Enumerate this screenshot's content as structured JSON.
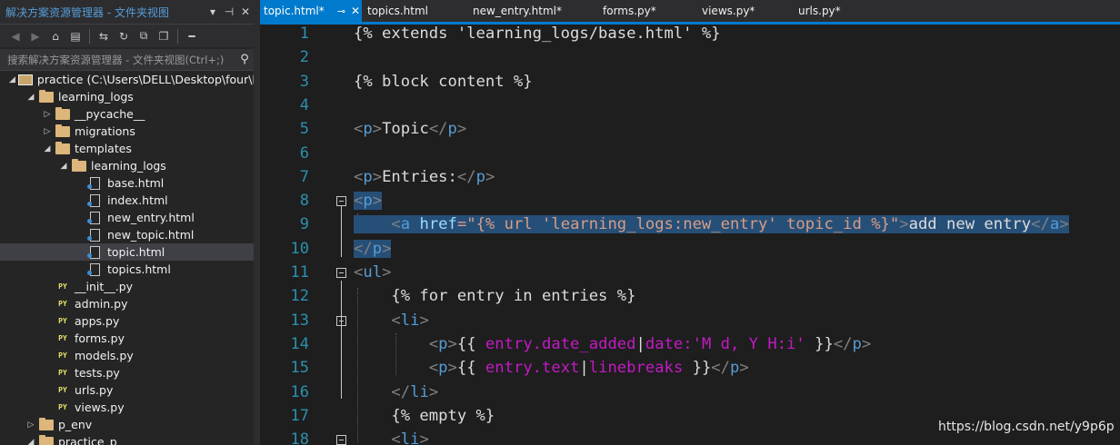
{
  "explorer": {
    "title": "解决方案资源管理器 - 文件夹视图",
    "title_controls": [
      "▾",
      "⊣",
      "✕"
    ],
    "search_placeholder": "搜索解决方案资源管理器 - 文件夹视图(Ctrl+;)",
    "tree": [
      {
        "label": "practice (C:\\Users\\DELL\\Desktop\\four\\l",
        "kind": "proj",
        "depth": 0,
        "arrow": "◢"
      },
      {
        "label": "learning_logs",
        "kind": "folder",
        "depth": 1,
        "arrow": "◢"
      },
      {
        "label": "__pycache__",
        "kind": "folder",
        "depth": 2,
        "arrow": "▷"
      },
      {
        "label": "migrations",
        "kind": "folder",
        "depth": 2,
        "arrow": "▷"
      },
      {
        "label": "templates",
        "kind": "folder",
        "depth": 2,
        "arrow": "◢"
      },
      {
        "label": "learning_logs",
        "kind": "folder",
        "depth": 3,
        "arrow": "◢"
      },
      {
        "label": "base.html",
        "kind": "file",
        "depth": 4,
        "arrow": ""
      },
      {
        "label": "index.html",
        "kind": "file",
        "depth": 4,
        "arrow": ""
      },
      {
        "label": "new_entry.html",
        "kind": "file",
        "depth": 4,
        "arrow": ""
      },
      {
        "label": "new_topic.html",
        "kind": "file",
        "depth": 4,
        "arrow": ""
      },
      {
        "label": "topic.html",
        "kind": "file",
        "depth": 4,
        "arrow": "",
        "selected": true
      },
      {
        "label": "topics.html",
        "kind": "file",
        "depth": 4,
        "arrow": ""
      },
      {
        "label": "__init__.py",
        "kind": "py",
        "depth": 2,
        "arrow": ""
      },
      {
        "label": "admin.py",
        "kind": "py",
        "depth": 2,
        "arrow": ""
      },
      {
        "label": "apps.py",
        "kind": "py",
        "depth": 2,
        "arrow": ""
      },
      {
        "label": "forms.py",
        "kind": "py",
        "depth": 2,
        "arrow": ""
      },
      {
        "label": "models.py",
        "kind": "py",
        "depth": 2,
        "arrow": ""
      },
      {
        "label": "tests.py",
        "kind": "py",
        "depth": 2,
        "arrow": ""
      },
      {
        "label": "urls.py",
        "kind": "py",
        "depth": 2,
        "arrow": ""
      },
      {
        "label": "views.py",
        "kind": "py",
        "depth": 2,
        "arrow": ""
      },
      {
        "label": "p_env",
        "kind": "folder",
        "depth": 1,
        "arrow": "▷"
      },
      {
        "label": "practice_p",
        "kind": "folder",
        "depth": 1,
        "arrow": "◢"
      }
    ]
  },
  "tabs": [
    {
      "label": "topic.html*",
      "active": true
    },
    {
      "label": "topics.html",
      "active": false
    },
    {
      "label": "new_entry.html*",
      "active": false
    },
    {
      "label": "forms.py*",
      "active": false
    },
    {
      "label": "views.py*",
      "active": false
    },
    {
      "label": "urls.py*",
      "active": false
    }
  ],
  "editor": {
    "lines": [
      {
        "n": "1",
        "fold": false,
        "segs": [
          [
            "{% extends 'learning_logs/base.html' %}",
            ""
          ]
        ]
      },
      {
        "n": "2",
        "fold": false,
        "segs": []
      },
      {
        "n": "3",
        "fold": false,
        "segs": [
          [
            "{% block content %}",
            ""
          ]
        ]
      },
      {
        "n": "4",
        "fold": false,
        "segs": []
      },
      {
        "n": "5",
        "fold": false,
        "segs": [
          [
            "<",
            "g"
          ],
          [
            "p",
            "t"
          ],
          [
            ">",
            "g"
          ],
          [
            "Topic",
            ""
          ],
          [
            "</",
            "g"
          ],
          [
            "p",
            "t"
          ],
          [
            ">",
            "g"
          ]
        ]
      },
      {
        "n": "6",
        "fold": false,
        "segs": []
      },
      {
        "n": "7",
        "fold": false,
        "segs": [
          [
            "<",
            "g"
          ],
          [
            "p",
            "t"
          ],
          [
            ">",
            "g"
          ],
          [
            "Entries:",
            ""
          ],
          [
            "</",
            "g"
          ],
          [
            "p",
            "t"
          ],
          [
            ">",
            "g"
          ]
        ]
      },
      {
        "n": "8",
        "fold": true,
        "hl": true,
        "segs": [
          [
            "<",
            "g"
          ],
          [
            "p",
            "t"
          ],
          [
            ">",
            "g"
          ]
        ]
      },
      {
        "n": "9",
        "fold": false,
        "hl": true,
        "segs": [
          [
            "    ",
            ""
          ],
          [
            "<",
            "g"
          ],
          [
            "a",
            "t"
          ],
          [
            " ",
            ""
          ],
          [
            "href",
            "a"
          ],
          [
            "=\"{% url 'learning_logs:new_entry' topic_id %}\"",
            "s"
          ],
          [
            ">",
            "g"
          ],
          [
            "add new entry",
            ""
          ],
          [
            "</",
            "g"
          ],
          [
            "a",
            "t"
          ],
          [
            ">",
            "g"
          ]
        ]
      },
      {
        "n": "10",
        "fold": false,
        "hl": true,
        "segs": [
          [
            "</",
            "g"
          ],
          [
            "p",
            "t"
          ],
          [
            ">",
            "g"
          ]
        ]
      },
      {
        "n": "11",
        "fold": true,
        "segs": [
          [
            "<",
            "g"
          ],
          [
            "ul",
            "t"
          ],
          [
            ">",
            "g"
          ]
        ]
      },
      {
        "n": "12",
        "fold": false,
        "segs": [
          [
            "    {% for entry in entries %}",
            ""
          ]
        ]
      },
      {
        "n": "13",
        "fold": true,
        "segs": [
          [
            "    ",
            ""
          ],
          [
            "<",
            "g"
          ],
          [
            "li",
            "t"
          ],
          [
            ">",
            "g"
          ]
        ]
      },
      {
        "n": "14",
        "fold": false,
        "segs": [
          [
            "        ",
            ""
          ],
          [
            "<",
            "g"
          ],
          [
            "p",
            "t"
          ],
          [
            ">",
            "g"
          ],
          [
            "{{ ",
            ""
          ],
          [
            "entry.date_added",
            "m"
          ],
          [
            "|",
            ""
          ],
          [
            "date:'M d, Y H:i'",
            "m"
          ],
          [
            " }}",
            ""
          ],
          [
            "</",
            "g"
          ],
          [
            "p",
            "t"
          ],
          [
            ">",
            "g"
          ]
        ]
      },
      {
        "n": "15",
        "fold": false,
        "segs": [
          [
            "        ",
            ""
          ],
          [
            "<",
            "g"
          ],
          [
            "p",
            "t"
          ],
          [
            ">",
            "g"
          ],
          [
            "{{ ",
            ""
          ],
          [
            "entry.text",
            "m"
          ],
          [
            "|",
            ""
          ],
          [
            "linebreaks",
            "m"
          ],
          [
            " }}",
            ""
          ],
          [
            "</",
            "g"
          ],
          [
            "p",
            "t"
          ],
          [
            ">",
            "g"
          ]
        ]
      },
      {
        "n": "16",
        "fold": false,
        "segs": [
          [
            "    ",
            ""
          ],
          [
            "</",
            "g"
          ],
          [
            "li",
            "t"
          ],
          [
            ">",
            "g"
          ]
        ]
      },
      {
        "n": "17",
        "fold": false,
        "segs": [
          [
            "    {% empty %}",
            ""
          ]
        ]
      },
      {
        "n": "18",
        "fold": true,
        "segs": [
          [
            "    ",
            ""
          ],
          [
            "<",
            "g"
          ],
          [
            "li",
            "t"
          ],
          [
            ">",
            "g"
          ]
        ]
      }
    ]
  },
  "watermark": "https://blog.csdn.net/y9p6p"
}
